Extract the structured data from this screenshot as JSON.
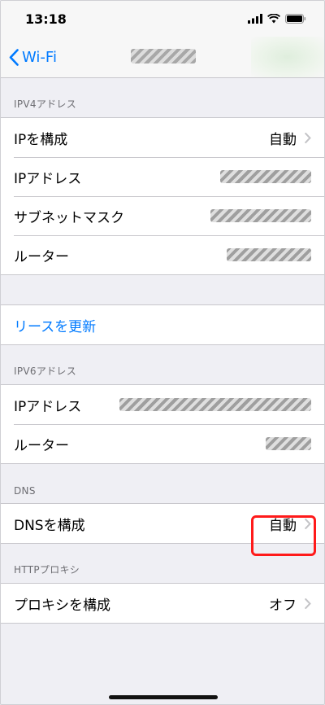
{
  "status": {
    "time": "13:18"
  },
  "nav": {
    "back_label": "Wi-Fi"
  },
  "ipv4": {
    "header": "IPV4アドレス",
    "configure_label": "IPを構成",
    "configure_value": "自動",
    "ip_label": "IPアドレス",
    "subnet_label": "サブネットマスク",
    "router_label": "ルーター"
  },
  "lease": {
    "renew_label": "リースを更新"
  },
  "ipv6": {
    "header": "IPV6アドレス",
    "ip_label": "IPアドレス",
    "router_label": "ルーター"
  },
  "dns": {
    "header": "DNS",
    "configure_label": "DNSを構成",
    "configure_value": "自動"
  },
  "proxy": {
    "header": "HTTPプロキシ",
    "configure_label": "プロキシを構成",
    "configure_value": "オフ"
  },
  "colors": {
    "accent": "#007aff",
    "highlight": "#ff1a1a"
  }
}
